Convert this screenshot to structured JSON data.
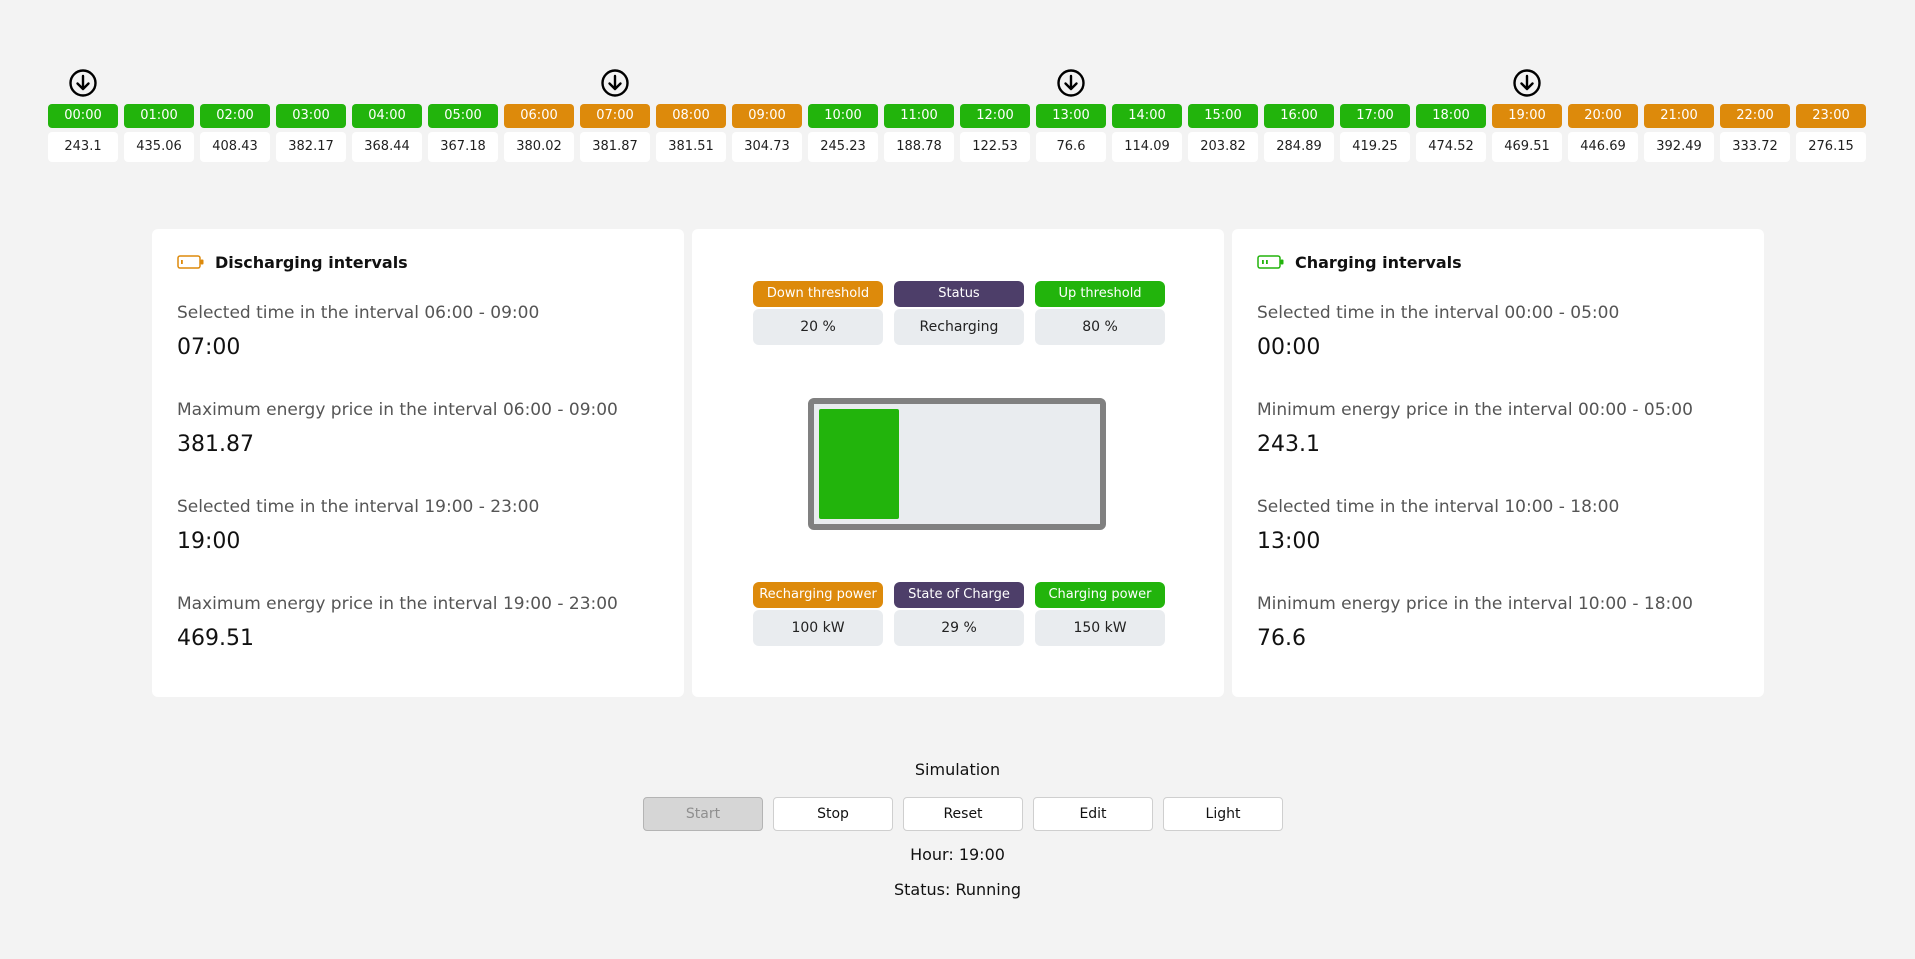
{
  "timeline": {
    "hours": [
      {
        "time": "00:00",
        "price": "243.1",
        "mode": "charge",
        "marker": true
      },
      {
        "time": "01:00",
        "price": "435.06",
        "mode": "charge",
        "marker": false
      },
      {
        "time": "02:00",
        "price": "408.43",
        "mode": "charge",
        "marker": false
      },
      {
        "time": "03:00",
        "price": "382.17",
        "mode": "charge",
        "marker": false
      },
      {
        "time": "04:00",
        "price": "368.44",
        "mode": "charge",
        "marker": false
      },
      {
        "time": "05:00",
        "price": "367.18",
        "mode": "charge",
        "marker": false
      },
      {
        "time": "06:00",
        "price": "380.02",
        "mode": "discharge",
        "marker": false
      },
      {
        "time": "07:00",
        "price": "381.87",
        "mode": "discharge",
        "marker": true
      },
      {
        "time": "08:00",
        "price": "381.51",
        "mode": "discharge",
        "marker": false
      },
      {
        "time": "09:00",
        "price": "304.73",
        "mode": "discharge",
        "marker": false
      },
      {
        "time": "10:00",
        "price": "245.23",
        "mode": "charge",
        "marker": false
      },
      {
        "time": "11:00",
        "price": "188.78",
        "mode": "charge",
        "marker": false
      },
      {
        "time": "12:00",
        "price": "122.53",
        "mode": "charge",
        "marker": false
      },
      {
        "time": "13:00",
        "price": "76.6",
        "mode": "charge",
        "marker": true
      },
      {
        "time": "14:00",
        "price": "114.09",
        "mode": "charge",
        "marker": false
      },
      {
        "time": "15:00",
        "price": "203.82",
        "mode": "charge",
        "marker": false
      },
      {
        "time": "16:00",
        "price": "284.89",
        "mode": "charge",
        "marker": false
      },
      {
        "time": "17:00",
        "price": "419.25",
        "mode": "charge",
        "marker": false
      },
      {
        "time": "18:00",
        "price": "474.52",
        "mode": "charge",
        "marker": false
      },
      {
        "time": "19:00",
        "price": "469.51",
        "mode": "discharge",
        "marker": true
      },
      {
        "time": "20:00",
        "price": "446.69",
        "mode": "discharge",
        "marker": false
      },
      {
        "time": "21:00",
        "price": "392.49",
        "mode": "discharge",
        "marker": false
      },
      {
        "time": "22:00",
        "price": "333.72",
        "mode": "discharge",
        "marker": false
      },
      {
        "time": "23:00",
        "price": "276.15",
        "mode": "discharge",
        "marker": false
      }
    ]
  },
  "discharging": {
    "title": "Discharging intervals",
    "icon": "battery-low-icon",
    "rows": [
      {
        "label": "Selected time in the interval 06:00 - 09:00",
        "value": "07:00"
      },
      {
        "label": "Maximum energy price in the interval 06:00 - 09:00",
        "value": "381.87"
      },
      {
        "label": "Selected time in the interval 19:00 - 23:00",
        "value": "19:00"
      },
      {
        "label": "Maximum energy price in the interval 19:00 - 23:00",
        "value": "469.51"
      }
    ]
  },
  "charging": {
    "title": "Charging intervals",
    "icon": "battery-charging-icon",
    "rows": [
      {
        "label": "Selected time in the interval 00:00 - 05:00",
        "value": "00:00"
      },
      {
        "label": "Minimum energy price in the interval 00:00 - 05:00",
        "value": "243.1"
      },
      {
        "label": "Selected time in the interval 10:00 - 18:00",
        "value": "13:00"
      },
      {
        "label": "Minimum energy price in the interval 10:00 - 18:00",
        "value": "76.6"
      }
    ]
  },
  "battery_panel": {
    "top": [
      {
        "label": "Down threshold",
        "value": "20 %",
        "color": "orange"
      },
      {
        "label": "Status",
        "value": "Recharging",
        "color": "purple"
      },
      {
        "label": "Up threshold",
        "value": "80 %",
        "color": "green"
      }
    ],
    "bottom": [
      {
        "label": "Recharging power",
        "value": "100 kW",
        "color": "orange"
      },
      {
        "label": "State of Charge",
        "value": "29 %",
        "color": "purple"
      },
      {
        "label": "Charging power",
        "value": "150 kW",
        "color": "green"
      }
    ],
    "state_of_charge": 0.29
  },
  "simulation": {
    "title": "Simulation",
    "buttons": {
      "start": "Start",
      "stop": "Stop",
      "reset": "Reset",
      "edit": "Edit",
      "light": "Light"
    },
    "hour_text": "Hour: 19:00",
    "status_text": "Status: Running"
  },
  "colors": {
    "charge": "#22b40c",
    "discharge": "#dd8a0b",
    "status": "#4d3e69",
    "background": "#f3f3f3"
  }
}
